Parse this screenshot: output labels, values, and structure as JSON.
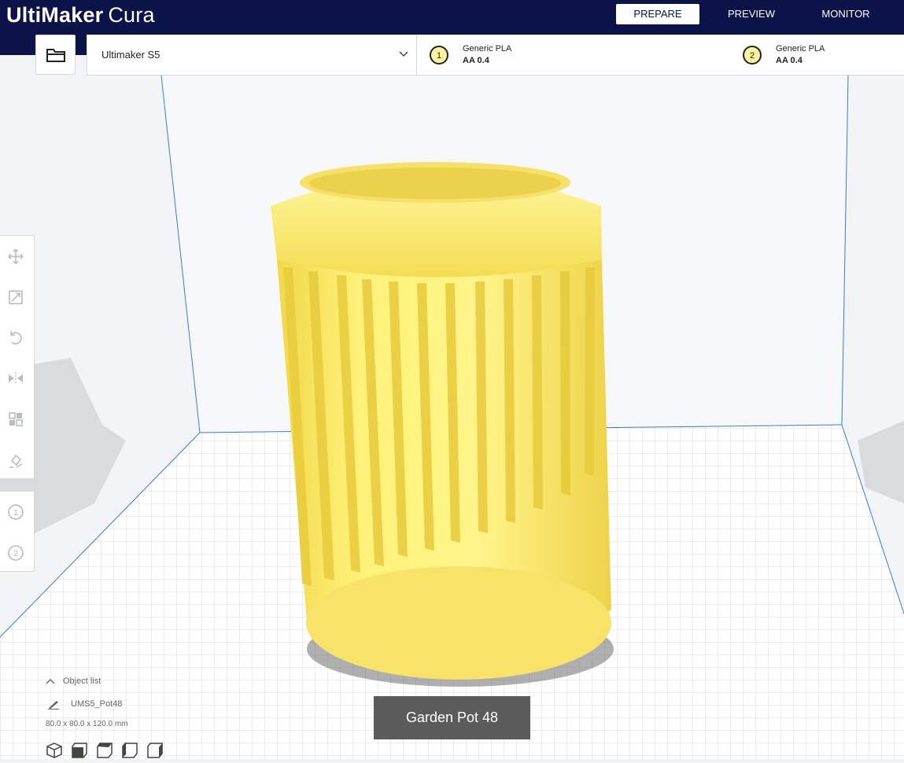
{
  "app": {
    "brand": "UltiMaker",
    "product": "Cura"
  },
  "stages": [
    {
      "label": "PREPARE",
      "active": true
    },
    {
      "label": "PREVIEW",
      "active": false
    },
    {
      "label": "MONITOR",
      "active": false
    }
  ],
  "toolbar": {
    "open_icon": "folder-icon",
    "machine": "Ultimaker S5",
    "extruders": [
      {
        "number": "1",
        "material": "Generic PLA",
        "nozzle": "AA 0.4"
      },
      {
        "number": "2",
        "material": "Generic PLA",
        "nozzle": "AA 0.4"
      }
    ]
  },
  "tools": [
    {
      "name": "move-icon"
    },
    {
      "name": "scale-icon"
    },
    {
      "name": "rotate-icon"
    },
    {
      "name": "mirror-icon"
    },
    {
      "name": "per-model-settings-icon"
    },
    {
      "name": "support-blocker-icon"
    }
  ],
  "extruder_tools": [
    {
      "label": "1"
    },
    {
      "label": "2"
    }
  ],
  "object_list": {
    "header": "Object list",
    "object_name": "UMS5_Pot48",
    "dimensions": "80.0 x 80.0 x 120.0 mm",
    "view_buttons": [
      "3d-view-icon",
      "front-view-icon",
      "top-view-icon",
      "left-view-icon",
      "right-view-icon"
    ]
  },
  "tooltip": "Garden Pot 48",
  "colors": {
    "header_bg": "#0b1348",
    "model_yellow": "#fff176",
    "build_plate": "#ffffff",
    "grid_line": "#cfd3d8",
    "volume_edge": "#3a7bd5"
  }
}
